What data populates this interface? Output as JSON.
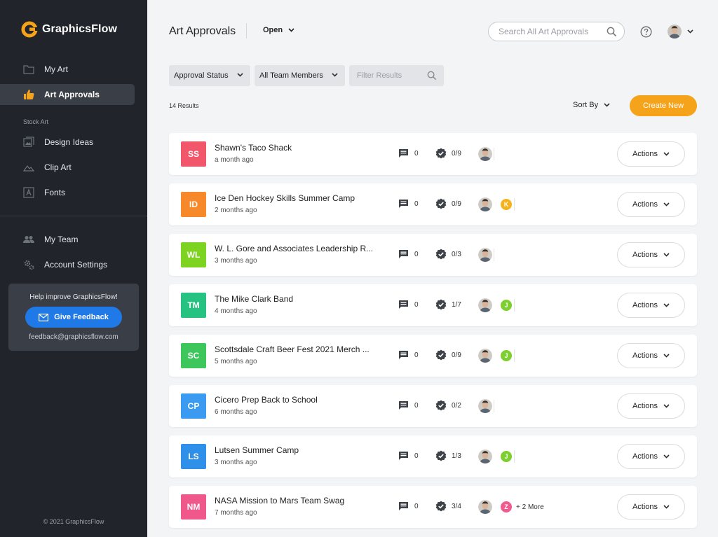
{
  "sidebar": {
    "brand": "GraphicsFlow",
    "items": [
      {
        "label": "My Art",
        "icon": "folder-icon"
      },
      {
        "label": "Art Approvals",
        "icon": "thumbs-up-icon",
        "active": true
      }
    ],
    "stock_label": "Stock Art",
    "stock_items": [
      {
        "label": "Design Ideas",
        "icon": "design-ideas-icon"
      },
      {
        "label": "Clip Art",
        "icon": "mountain-icon"
      },
      {
        "label": "Fonts",
        "icon": "font-icon"
      }
    ],
    "account_items": [
      {
        "label": "My Team",
        "icon": "team-icon"
      },
      {
        "label": "Account Settings",
        "icon": "gears-icon"
      }
    ],
    "feedback": {
      "title": "Help improve GraphicsFlow!",
      "button": "Give Feedback",
      "email": "feedback@graphicsflow.com"
    },
    "copyright": "© 2021 GraphicsFlow"
  },
  "header": {
    "title": "Art Approvals",
    "status": "Open",
    "search_placeholder": "Search All Art Approvals"
  },
  "filters": {
    "approval_status": "Approval Status",
    "team_members": "All Team Members",
    "filter_placeholder": "Filter Results"
  },
  "results_count": "14 Results",
  "sort_label": "Sort By",
  "create_label": "Create New",
  "colors": {
    "accent": "#f5a31a",
    "brand_blue": "#1f7ae8",
    "sidebar_bg": "#21252b"
  },
  "rows": [
    {
      "initials": "SS",
      "color": "#f2566b",
      "name": "Shawn's Taco Shack",
      "time": "a month ago",
      "comments": "0",
      "approvals": "0/9",
      "members": [],
      "actions": "Actions"
    },
    {
      "initials": "ID",
      "color": "#f7892a",
      "name": "Ice Den Hockey Skills Summer Camp",
      "time": "2 months ago",
      "comments": "0",
      "approvals": "0/9",
      "members": [
        {
          "initial": "K",
          "color": "#f5b21e"
        }
      ],
      "actions": "Actions"
    },
    {
      "initials": "WL",
      "color": "#7ed321",
      "name": "W. L. Gore and Associates Leadership R...",
      "time": "3 months ago",
      "comments": "0",
      "approvals": "0/3",
      "members": [],
      "actions": "Actions"
    },
    {
      "initials": "TM",
      "color": "#26c281",
      "name": "The Mike Clark Band",
      "time": "4 months ago",
      "comments": "0",
      "approvals": "1/7",
      "members": [
        {
          "initial": "J",
          "color": "#7ccf2f"
        }
      ],
      "actions": "Actions"
    },
    {
      "initials": "SC",
      "color": "#3cc65c",
      "name": "Scottsdale Craft Beer Fest 2021 Merch ...",
      "time": "5 months ago",
      "comments": "0",
      "approvals": "0/9",
      "members": [
        {
          "initial": "J",
          "color": "#7ccf2f"
        }
      ],
      "actions": "Actions"
    },
    {
      "initials": "CP",
      "color": "#3a9bf0",
      "name": "Cicero Prep Back to School",
      "time": "6 months ago",
      "comments": "0",
      "approvals": "0/2",
      "members": [],
      "actions": "Actions"
    },
    {
      "initials": "LS",
      "color": "#2e90e8",
      "name": "Lutsen Summer Camp",
      "time": "3 months ago",
      "comments": "0",
      "approvals": "1/3",
      "members": [
        {
          "initial": "J",
          "color": "#7ccf2f"
        }
      ],
      "actions": "Actions"
    },
    {
      "initials": "NM",
      "color": "#f0578a",
      "name": "NASA Mission to Mars Team Swag",
      "time": "7 months ago",
      "comments": "0",
      "approvals": "3/4",
      "members": [
        {
          "initial": "Z",
          "color": "#ef5a8f"
        }
      ],
      "more": "+ 2 More",
      "actions": "Actions"
    }
  ]
}
